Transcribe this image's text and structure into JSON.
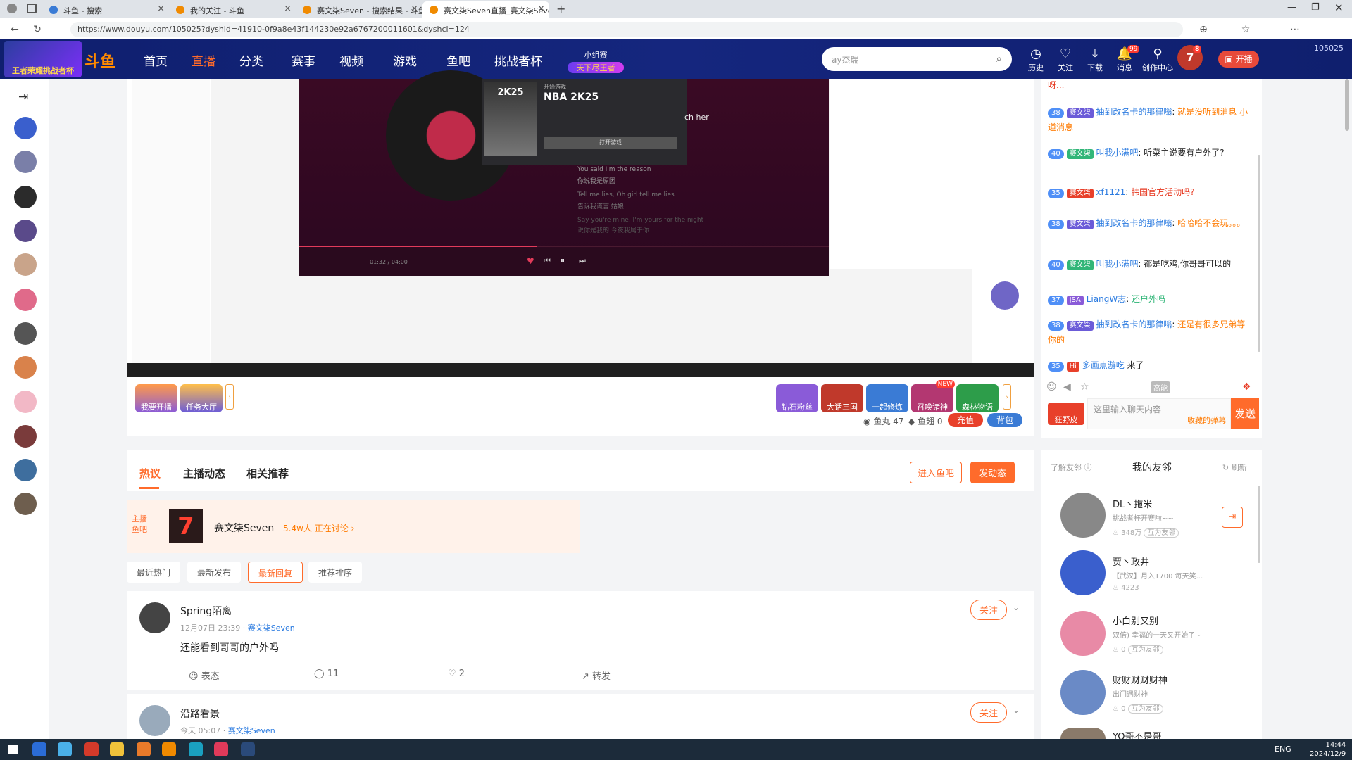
{
  "browser": {
    "tabs": [
      {
        "title": "斗鱼 - 搜索",
        "active": false
      },
      {
        "title": "我的关注 - 斗鱼",
        "active": false
      },
      {
        "title": "赛文柒Seven - 搜索结果 - 斗鱼直播",
        "active": false
      },
      {
        "title": "赛文柒Seven直播_赛文柒Seven户外",
        "active": true
      }
    ],
    "url": "https://www.douyu.com/105025?dyshid=41910-0f9a8e43f144230e92a6767200011601&dyshci=124"
  },
  "header": {
    "logo_text": "斗鱼",
    "event_banner": "王者荣耀挑战者杯",
    "nav": [
      {
        "label": "首页",
        "active": false
      },
      {
        "label": "直播",
        "active": true
      },
      {
        "label": "分类",
        "active": false
      },
      {
        "label": "赛事",
        "active": false
      },
      {
        "label": "视频",
        "active": false
      },
      {
        "label": "游戏",
        "active": false
      },
      {
        "label": "鱼吧",
        "active": false
      },
      {
        "label": "挑战者杯",
        "active": false
      }
    ],
    "promo_top": "小组赛",
    "promo_bottom": "天下尽王者",
    "search_placeholder": "ay杰瑞",
    "icons": [
      {
        "label": "历史",
        "icon": "clock-icon"
      },
      {
        "label": "关注",
        "icon": "heart-icon"
      },
      {
        "label": "下载",
        "icon": "download-icon"
      },
      {
        "label": "消息",
        "icon": "bell-icon",
        "badge": "99"
      },
      {
        "label": "创作中心",
        "icon": "bulb-icon"
      }
    ],
    "user_badge": "8",
    "start_live": "开播",
    "room_id": "105025"
  },
  "music": {
    "now_playing_label": "开始游戏",
    "game_title": "NBA 2K25",
    "game_logo": "2K25",
    "lyrics": [
      "ch her",
      "You said I'm the reason",
      "你说我是原因",
      "Tell me lies, Oh girl tell me lies",
      "告诉我谎言 姑娘",
      "Say you're mine, I'm yours for the night",
      "说你是我的 今夜我属于你"
    ],
    "time": "01:32 / 04:00",
    "open_btn": "打开游戏"
  },
  "gifts": {
    "left": [
      {
        "label": "我要开播"
      },
      {
        "label": "任务大厅"
      }
    ],
    "right": [
      {
        "label": "钻石粉丝",
        "color": "#8a5bd8"
      },
      {
        "label": "大话三国",
        "color": "#c0392b"
      },
      {
        "label": "一起修炼",
        "color": "#3a7bd5"
      },
      {
        "label": "召唤诸神",
        "color": "#b33771",
        "tag": "NEW"
      },
      {
        "label": "森林物语",
        "color": "#2d9d4a"
      }
    ],
    "yuwan": "鱼丸 47",
    "yuchi": "鱼翅 0",
    "recharge": "充值",
    "bag": "背包"
  },
  "chat": {
    "top_fragment": "呀...",
    "messages": [
      {
        "level": "38",
        "fan_lv": "37",
        "fan": "赛文柒",
        "user": "抽到改名卡的那律嗡",
        "text": "就是没听到消息 小道消息",
        "color": "org"
      },
      {
        "level": "40",
        "fan_lv": "9",
        "fan": "赛文柒",
        "user": "叫我小满吧",
        "text": "听菜主说要有户外了?",
        "color": ""
      },
      {
        "level": "35",
        "fan_lv": "21",
        "fan": "赛文柒",
        "user": "xf1121",
        "text": "韩国官方活动吗?",
        "color": "red"
      },
      {
        "level": "38",
        "fan_lv": "17",
        "fan": "赛文柒",
        "user": "抽到改名卡的那律嗡",
        "text": "哈哈哈不会玩。。。",
        "color": "org"
      },
      {
        "level": "40",
        "fan_lv": "9",
        "fan": "赛文柒",
        "user": "叫我小满吧",
        "text": "都是吃鸡,你哥哥可以的",
        "color": ""
      },
      {
        "level": "37",
        "fan_lv": "",
        "fan": "JSA",
        "user": "LiangW志",
        "text": "还户外吗",
        "color": "grn"
      },
      {
        "level": "38",
        "fan_lv": "17",
        "fan": "赛文柒",
        "user": "抽到改名卡的那律嗡",
        "text": "还是有很多兄弟等你的",
        "color": "org"
      },
      {
        "level": "35",
        "fan_lv": "",
        "fan": "Hi",
        "user": "多画点游吃",
        "text": "来了",
        "color": ""
      }
    ],
    "tools_label": "高能",
    "input_placeholder": "这里输入聊天内容",
    "barrage_label": "收藏的弹幕",
    "send": "发送",
    "crazy_label": "狂野皮"
  },
  "feed": {
    "tabs": [
      {
        "label": "热议",
        "active": true
      },
      {
        "label": "主播动态",
        "active": false
      },
      {
        "label": "相关推荐",
        "active": false
      }
    ],
    "enter_bar": "进入鱼吧",
    "post_btn": "发动态",
    "bar_badge_top": "主播",
    "bar_badge_bottom": "鱼吧",
    "bar_name": "赛文柒Seven",
    "bar_stats": "5.4w人 正在讨论",
    "sorts": [
      {
        "label": "最近热门",
        "active": false
      },
      {
        "label": "最新发布",
        "active": false
      },
      {
        "label": "最新回复",
        "active": true
      },
      {
        "label": "推荐排序",
        "active": false
      }
    ],
    "posts": [
      {
        "user": "Spring陌离",
        "time": "12月07日 23:39",
        "source": "赛文柒Seven",
        "text": "还能看到哥哥的户外吗",
        "follow": "关注",
        "react": "表态",
        "comments": "11",
        "likes": "2",
        "share": "转发"
      },
      {
        "user": "沿路看景",
        "time": "今天 05:07",
        "source": "赛文柒Seven",
        "text": "",
        "follow": "关注"
      }
    ]
  },
  "friends": {
    "learn": "了解友邻",
    "title": "我的友邻",
    "refresh": "刷新",
    "list": [
      {
        "name": "DL丶拖米",
        "desc": "挑战者杯开赛啦~~",
        "heat": "348万",
        "tag": "互为友邻"
      },
      {
        "name": "贾丶政井",
        "desc": "【武汉】月入1700 每天笑...",
        "heat": "4223",
        "tag": ""
      },
      {
        "name": "小白别又别",
        "desc": "双倍) 幸福的一天又开始了~",
        "heat": "0",
        "tag": "互为友邻"
      },
      {
        "name": "财财财财财神",
        "desc": "出门遇财神",
        "heat": "0",
        "tag": "互为友邻"
      },
      {
        "name": "YO哥不是哥",
        "desc": "",
        "heat": "",
        "tag": ""
      }
    ]
  },
  "taskbar": {
    "time": "14:44",
    "date": "2024/12/9",
    "lang": "ENG"
  }
}
